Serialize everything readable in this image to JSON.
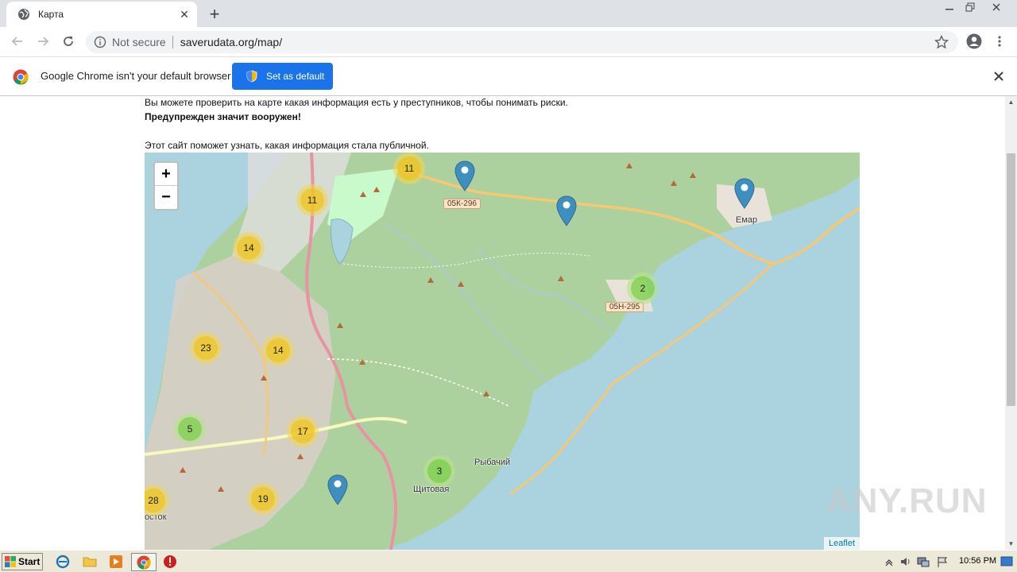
{
  "browser": {
    "tab_title": "Карта",
    "security_label": "Not secure",
    "url": "saverudata.org/map/"
  },
  "infobar": {
    "message": "Google Chrome isn't your default browser",
    "button_label": "Set as default"
  },
  "page": {
    "line1": "Вы можете проверить на карте какая информация есть у преступников, чтобы понимать риски.",
    "line2": "Предупрежден значит вооружен!",
    "line3": "Этот сайт поможет узнать, какая информация стала публичной."
  },
  "map": {
    "zoom_in": "+",
    "zoom_out": "−",
    "clusters": [
      "11",
      "11",
      "14",
      "23",
      "14",
      "5",
      "17",
      "28",
      "19",
      "3",
      "2"
    ],
    "road_labels": [
      "05К-296",
      "05Н-295"
    ],
    "place_labels": [
      "Емар",
      "Рыбачий",
      "Щитовая",
      "осток"
    ],
    "attribution": "Leaflet",
    "colors": {
      "water": "#aad3df",
      "forest": "#add19e",
      "road": "#f7c873",
      "cluster_yellow": "#f0c20c",
      "cluster_green": "#6ecc39",
      "marker": "#3e8ebf"
    }
  },
  "taskbar": {
    "start_label": "Start",
    "clock": "10:56 PM"
  },
  "watermark": "ANY.RUN"
}
